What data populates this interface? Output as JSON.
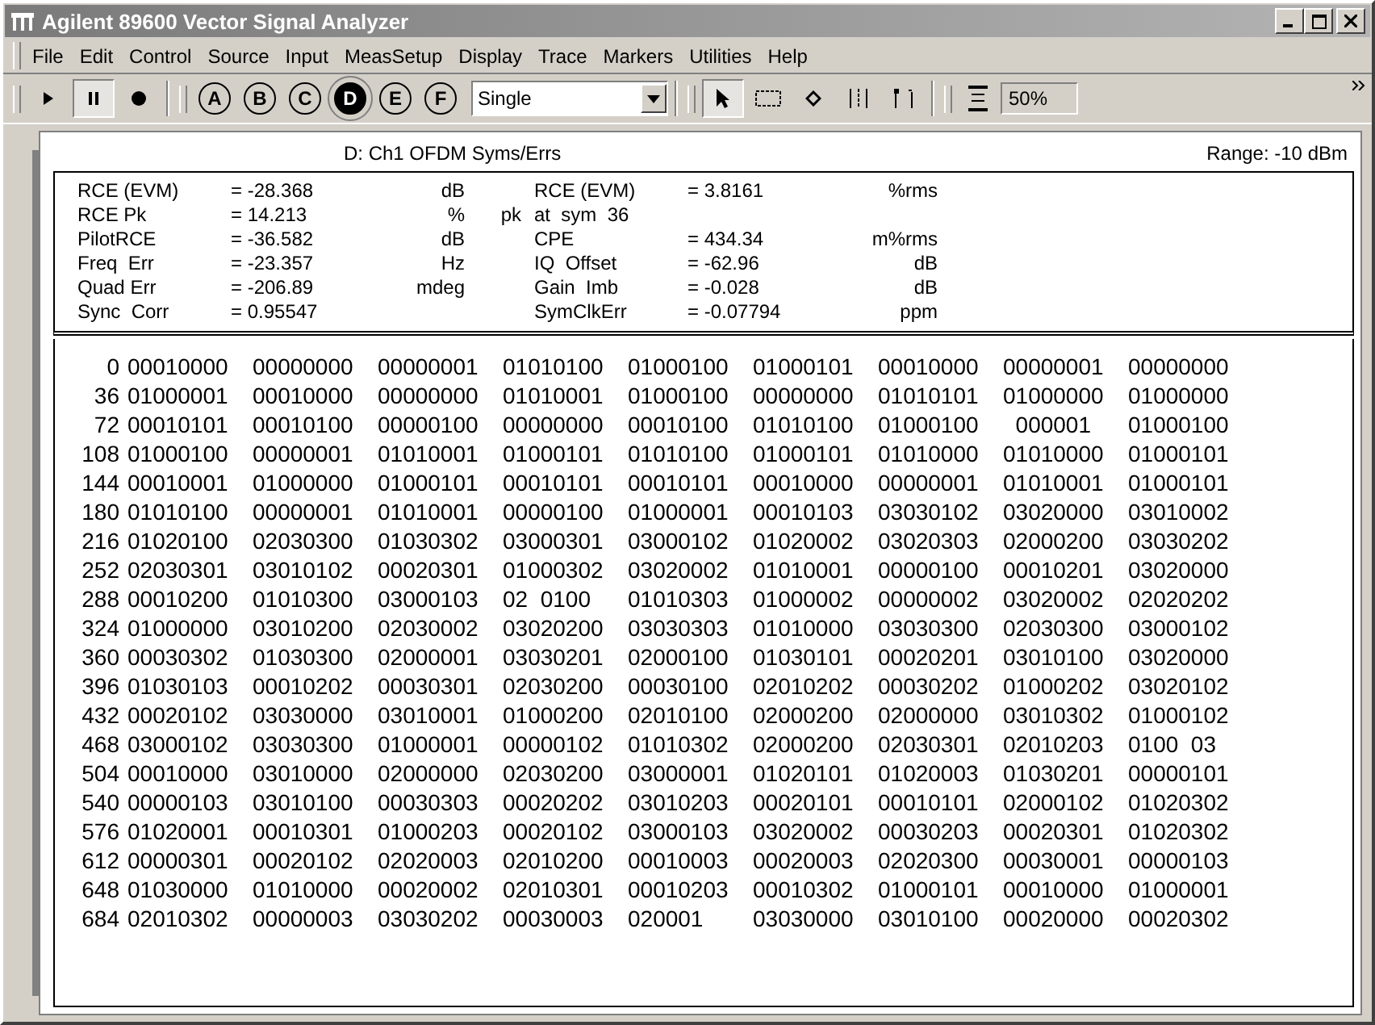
{
  "window": {
    "title": "Agilent 89600 Vector Signal Analyzer"
  },
  "menu": [
    "File",
    "Edit",
    "Control",
    "Source",
    "Input",
    "MeasSetup",
    "Display",
    "Trace",
    "Markers",
    "Utilities",
    "Help"
  ],
  "transport": [
    {
      "kind": "play",
      "pressed": false
    },
    {
      "kind": "pause",
      "pressed": true
    },
    {
      "kind": "record",
      "pressed": false
    }
  ],
  "traces": [
    {
      "label": "A",
      "selected": false
    },
    {
      "label": "B",
      "selected": false
    },
    {
      "label": "C",
      "selected": false
    },
    {
      "label": "D",
      "selected": true
    },
    {
      "label": "E",
      "selected": false
    },
    {
      "label": "F",
      "selected": false
    }
  ],
  "mode_dropdown": {
    "value": "Single"
  },
  "tools": [
    {
      "kind": "pointer",
      "pressed": true
    },
    {
      "kind": "zoom-box",
      "pressed": false
    },
    {
      "kind": "marker",
      "pressed": false
    },
    {
      "kind": "band",
      "pressed": false
    },
    {
      "kind": "offset",
      "pressed": false
    }
  ],
  "scale_field": {
    "value": "50%"
  },
  "trace_panel": {
    "title": "D: Ch1 OFDM Syms/Errs",
    "range": "Range: -10 dBm",
    "metrics": [
      {
        "left": {
          "label": "RCE (EVM)",
          "value": "= -28.368",
          "unit": "dB"
        },
        "right": {
          "label": "RCE (EVM)",
          "value": "= 3.8161",
          "unit": "%rms"
        }
      },
      {
        "left": {
          "label": "RCE Pk",
          "value": "= 14.213",
          "unit": "%",
          "note": "pk"
        },
        "right": {
          "label": "at  sym  36"
        }
      },
      {
        "left": {
          "label": "PilotRCE",
          "value": "= -36.582",
          "unit": "dB"
        },
        "right": {
          "label": "CPE",
          "value": "= 434.34",
          "unit": "m%rms"
        }
      },
      {
        "left": {
          "label": "Freq  Err",
          "value": "= -23.357",
          "unit": "Hz"
        },
        "right": {
          "label": "IQ  Offset",
          "value": "= -62.96",
          "unit": "dB"
        }
      },
      {
        "left": {
          "label": "Quad Err",
          "value": "= -206.89",
          "unit": "mdeg"
        },
        "right": {
          "label": "Gain  Imb",
          "value": "= -0.028",
          "unit": "dB"
        }
      },
      {
        "left": {
          "label": "Sync  Corr",
          "value": "= 0.95547"
        },
        "right": {
          "label": "SymClkErr",
          "value": "= -0.07794",
          "unit": "ppm"
        }
      }
    ],
    "symbol_rows": [
      {
        "index": "0",
        "cells": [
          "00010000",
          "00000000",
          "00000001",
          "01010100",
          "01000100",
          "01000101",
          "00010000",
          "00000001",
          "00000000"
        ]
      },
      {
        "index": "36",
        "cells": [
          "01000001",
          "00010000",
          "00000000",
          "01010001",
          "01000100",
          "00000000",
          "01010101",
          "01000000",
          "01000000"
        ]
      },
      {
        "index": "72",
        "cells": [
          "00010101",
          "00010100",
          "00000100",
          "00000000",
          "00010100",
          "01010100",
          "01000100",
          "  000001",
          "01000100"
        ]
      },
      {
        "index": "108",
        "cells": [
          "01000100",
          "00000001",
          "01010001",
          "01000101",
          "01010100",
          "01000101",
          "01010000",
          "01010000",
          "01000101"
        ]
      },
      {
        "index": "144",
        "cells": [
          "00010001",
          "01000000",
          "01000101",
          "00010101",
          "00010101",
          "00010000",
          "00000001",
          "01010001",
          "01000101"
        ]
      },
      {
        "index": "180",
        "cells": [
          "01010100",
          "00000001",
          "01010001",
          "00000100",
          "01000001",
          "00010103",
          "03030102",
          "03020000",
          "03010002"
        ]
      },
      {
        "index": "216",
        "cells": [
          "01020100",
          "02030300",
          "01030302",
          "03000301",
          "03000102",
          "01020002",
          "03020303",
          "02000200",
          "03030202"
        ]
      },
      {
        "index": "252",
        "cells": [
          "02030301",
          "03010102",
          "00020301",
          "01000302",
          "03020002",
          "01010001",
          "00000100",
          "00010201",
          "03020000"
        ]
      },
      {
        "index": "288",
        "cells": [
          "00010200",
          "01010300",
          "03000103",
          "02  0100",
          "01010303",
          "01000002",
          "00000002",
          "03020002",
          "02020202"
        ]
      },
      {
        "index": "324",
        "cells": [
          "01000000",
          "03010200",
          "02030002",
          "03020200",
          "03030303",
          "01010000",
          "03030300",
          "02030300",
          "03000102"
        ]
      },
      {
        "index": "360",
        "cells": [
          "00030302",
          "01030300",
          "02000001",
          "03030201",
          "02000100",
          "01030101",
          "00020201",
          "03010100",
          "03020000"
        ]
      },
      {
        "index": "396",
        "cells": [
          "01030103",
          "00010202",
          "00030301",
          "02030200",
          "00030100",
          "02010202",
          "00030202",
          "01000202",
          "03020102"
        ]
      },
      {
        "index": "432",
        "cells": [
          "00020102",
          "03030000",
          "03010001",
          "01000200",
          "02010100",
          "02000200",
          "02000000",
          "03010302",
          "01000102"
        ]
      },
      {
        "index": "468",
        "cells": [
          "03000102",
          "03030300",
          "01000001",
          "00000102",
          "01010302",
          "02000200",
          "02030301",
          "02010203",
          "0100  03"
        ]
      },
      {
        "index": "504",
        "cells": [
          "00010000",
          "03010000",
          "02000000",
          "02030200",
          "03000001",
          "01020101",
          "01020003",
          "01030201",
          "00000101"
        ]
      },
      {
        "index": "540",
        "cells": [
          "00000103",
          "03010100",
          "00030303",
          "00020202",
          "03010203",
          "00020101",
          "00010101",
          "02000102",
          "01020302"
        ]
      },
      {
        "index": "576",
        "cells": [
          "01020001",
          "00010301",
          "01000203",
          "00020102",
          "03000103",
          "03020002",
          "00030203",
          "00020301",
          "01020302"
        ]
      },
      {
        "index": "612",
        "cells": [
          "00000301",
          "00020102",
          "02020003",
          "02010200",
          "00010003",
          "00020003",
          "02020300",
          "00030001",
          "00000103"
        ]
      },
      {
        "index": "648",
        "cells": [
          "01030000",
          "01010000",
          "00020002",
          "02010301",
          "00010203",
          "00010302",
          "01000101",
          "00010000",
          "01000001"
        ]
      },
      {
        "index": "684",
        "cells": [
          "02010302",
          "00000003",
          "03030202",
          "00030003",
          "020001  ",
          "03030000",
          "03010100",
          "00020000",
          "00020302"
        ]
      }
    ]
  }
}
